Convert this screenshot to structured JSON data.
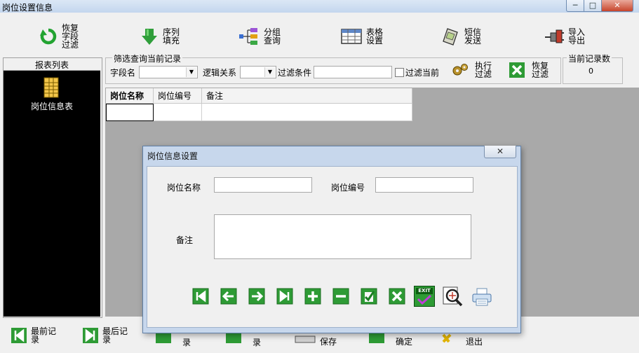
{
  "window": {
    "title": "岗位设置信息",
    "min_glyph": "─",
    "max_glyph": "□",
    "close_glyph": "✕"
  },
  "toolbar": [
    {
      "id": "restore-field-filter",
      "label": "恢复\n字段\n过滤",
      "icon": "refresh-icon"
    },
    {
      "id": "sequence-fill",
      "label": "序列\n填充",
      "icon": "down-arrow-icon"
    },
    {
      "id": "group-query",
      "label": "分组\n查询",
      "icon": "tree-icon"
    },
    {
      "id": "table-settings",
      "label": "表格\n设置",
      "icon": "table-icon"
    },
    {
      "id": "sms-send",
      "label": "短信\n发送",
      "icon": "phone-icon"
    },
    {
      "id": "import-export",
      "label": "导入\n导出",
      "icon": "plug-icon"
    }
  ],
  "report_list": {
    "title": "报表列表",
    "item_label": "岗位信息表"
  },
  "filter": {
    "legend": "筛选查询当前记录",
    "field_label": "字段名",
    "field_value": "",
    "logic_label": "逻辑关系",
    "logic_value": "",
    "condition_label": "过滤条件",
    "condition_value": "",
    "filter_current_label": "过滤当前",
    "execute_label": "执行\n过滤",
    "restore_label": "恢复\n过滤"
  },
  "record_count": {
    "legend": "当前记录数",
    "value": "0"
  },
  "grid": {
    "columns": [
      "岗位名称",
      "岗位编号",
      "备注"
    ],
    "rows": [
      [
        "",
        "",
        ""
      ]
    ]
  },
  "bottom_bar": [
    {
      "id": "first",
      "label": "最前记\n录"
    },
    {
      "id": "last",
      "label": "最后记\n录"
    },
    {
      "id": "prev",
      "label": "录"
    },
    {
      "id": "next",
      "label": "录"
    },
    {
      "id": "save",
      "label": "保存"
    },
    {
      "id": "confirm",
      "label": "确定"
    },
    {
      "id": "exit",
      "label": "退出"
    }
  ],
  "dialog": {
    "title": "岗位信息设置",
    "close_glyph": "✕",
    "name_label": "岗位名称",
    "name_value": "",
    "code_label": "岗位编号",
    "code_value": "",
    "note_label": "备注",
    "note_value": "",
    "exit_badge": "EXIT"
  },
  "colors": {
    "nav_green": "#2e9b35",
    "nav_green_light": "#4fc24f",
    "accent_blue": "#2f6fb3"
  }
}
